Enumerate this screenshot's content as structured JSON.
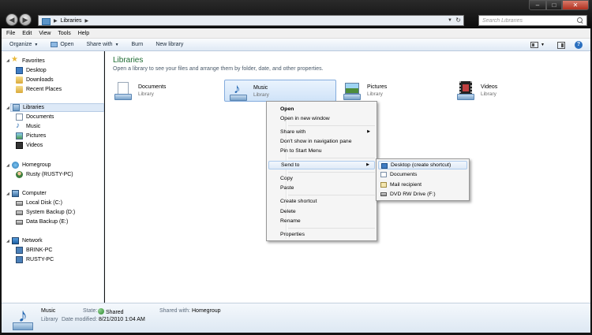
{
  "address": {
    "crumb": "Libraries"
  },
  "search": {
    "placeholder": "Search Libraries"
  },
  "menubar": [
    "File",
    "Edit",
    "View",
    "Tools",
    "Help"
  ],
  "toolbar": {
    "organize": "Organize",
    "open": "Open",
    "share_with": "Share with",
    "burn": "Burn",
    "new_library": "New library"
  },
  "nav": {
    "favorites": "Favorites",
    "desktop": "Desktop",
    "downloads": "Downloads",
    "recent_places": "Recent Places",
    "libraries": "Libraries",
    "documents": "Documents",
    "music": "Music",
    "pictures": "Pictures",
    "videos": "Videos",
    "homegroup": "Homegroup",
    "rusty": "Rusty (RUSTY-PC)",
    "computer": "Computer",
    "local_disk": "Local Disk (C:)",
    "system_backup": "System Backup (D:)",
    "data_backup": "Data Backup (E:)",
    "network": "Network",
    "brink_pc": "BRINK-PC",
    "rusty_pc": "RUSTY-PC"
  },
  "main": {
    "title": "Libraries",
    "subtitle": "Open a library to see your files and arrange them by folder, date, and other properties.",
    "libraries": [
      {
        "name": "Documents",
        "type": "Library",
        "icon": "documents-library-icon"
      },
      {
        "name": "Music",
        "type": "Library",
        "icon": "music-library-icon"
      },
      {
        "name": "Pictures",
        "type": "Library",
        "icon": "pictures-library-icon"
      },
      {
        "name": "Videos",
        "type": "Library",
        "icon": "videos-library-icon"
      }
    ]
  },
  "context_menu": {
    "open": "Open",
    "open_new_window": "Open in new window",
    "share_with": "Share with",
    "dont_show": "Don't show in navigation pane",
    "pin_start": "Pin to Start Menu",
    "send_to": "Send to",
    "copy": "Copy",
    "paste": "Paste",
    "create_shortcut": "Create shortcut",
    "delete": "Delete",
    "rename": "Rename",
    "properties": "Properties"
  },
  "send_to_menu": {
    "desktop": "Desktop (create shortcut)",
    "documents": "Documents",
    "mail": "Mail recipient",
    "dvd": "DVD RW Drive (F:)"
  },
  "details": {
    "name": "Music",
    "type": "Library",
    "state_label": "State:",
    "state_value": "Shared",
    "shared_with_label": "Shared with:",
    "shared_with_value": "Homegroup",
    "date_label": "Date modified:",
    "date_value": "8/21/2010 1:04 AM"
  },
  "colors": {
    "title_green": "#1e6b32",
    "selection_blue": "#cfe3f8",
    "close_red": "#b0301f"
  }
}
